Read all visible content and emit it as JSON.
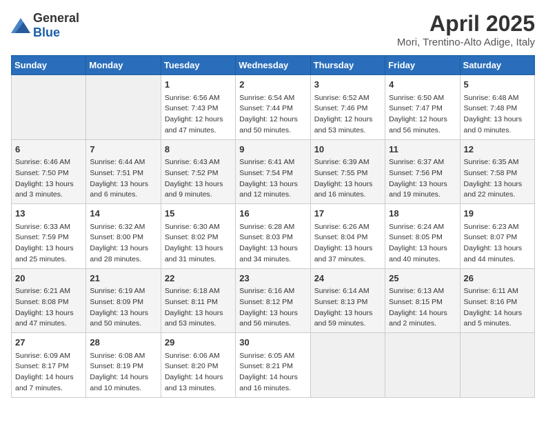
{
  "logo": {
    "text_general": "General",
    "text_blue": "Blue"
  },
  "title": "April 2025",
  "subtitle": "Mori, Trentino-Alto Adige, Italy",
  "days_of_week": [
    "Sunday",
    "Monday",
    "Tuesday",
    "Wednesday",
    "Thursday",
    "Friday",
    "Saturday"
  ],
  "weeks": [
    [
      {
        "day": "",
        "sunrise": "",
        "sunset": "",
        "daylight": ""
      },
      {
        "day": "",
        "sunrise": "",
        "sunset": "",
        "daylight": ""
      },
      {
        "day": "1",
        "sunrise": "Sunrise: 6:56 AM",
        "sunset": "Sunset: 7:43 PM",
        "daylight": "Daylight: 12 hours and 47 minutes."
      },
      {
        "day": "2",
        "sunrise": "Sunrise: 6:54 AM",
        "sunset": "Sunset: 7:44 PM",
        "daylight": "Daylight: 12 hours and 50 minutes."
      },
      {
        "day": "3",
        "sunrise": "Sunrise: 6:52 AM",
        "sunset": "Sunset: 7:46 PM",
        "daylight": "Daylight: 12 hours and 53 minutes."
      },
      {
        "day": "4",
        "sunrise": "Sunrise: 6:50 AM",
        "sunset": "Sunset: 7:47 PM",
        "daylight": "Daylight: 12 hours and 56 minutes."
      },
      {
        "day": "5",
        "sunrise": "Sunrise: 6:48 AM",
        "sunset": "Sunset: 7:48 PM",
        "daylight": "Daylight: 13 hours and 0 minutes."
      }
    ],
    [
      {
        "day": "6",
        "sunrise": "Sunrise: 6:46 AM",
        "sunset": "Sunset: 7:50 PM",
        "daylight": "Daylight: 13 hours and 3 minutes."
      },
      {
        "day": "7",
        "sunrise": "Sunrise: 6:44 AM",
        "sunset": "Sunset: 7:51 PM",
        "daylight": "Daylight: 13 hours and 6 minutes."
      },
      {
        "day": "8",
        "sunrise": "Sunrise: 6:43 AM",
        "sunset": "Sunset: 7:52 PM",
        "daylight": "Daylight: 13 hours and 9 minutes."
      },
      {
        "day": "9",
        "sunrise": "Sunrise: 6:41 AM",
        "sunset": "Sunset: 7:54 PM",
        "daylight": "Daylight: 13 hours and 12 minutes."
      },
      {
        "day": "10",
        "sunrise": "Sunrise: 6:39 AM",
        "sunset": "Sunset: 7:55 PM",
        "daylight": "Daylight: 13 hours and 16 minutes."
      },
      {
        "day": "11",
        "sunrise": "Sunrise: 6:37 AM",
        "sunset": "Sunset: 7:56 PM",
        "daylight": "Daylight: 13 hours and 19 minutes."
      },
      {
        "day": "12",
        "sunrise": "Sunrise: 6:35 AM",
        "sunset": "Sunset: 7:58 PM",
        "daylight": "Daylight: 13 hours and 22 minutes."
      }
    ],
    [
      {
        "day": "13",
        "sunrise": "Sunrise: 6:33 AM",
        "sunset": "Sunset: 7:59 PM",
        "daylight": "Daylight: 13 hours and 25 minutes."
      },
      {
        "day": "14",
        "sunrise": "Sunrise: 6:32 AM",
        "sunset": "Sunset: 8:00 PM",
        "daylight": "Daylight: 13 hours and 28 minutes."
      },
      {
        "day": "15",
        "sunrise": "Sunrise: 6:30 AM",
        "sunset": "Sunset: 8:02 PM",
        "daylight": "Daylight: 13 hours and 31 minutes."
      },
      {
        "day": "16",
        "sunrise": "Sunrise: 6:28 AM",
        "sunset": "Sunset: 8:03 PM",
        "daylight": "Daylight: 13 hours and 34 minutes."
      },
      {
        "day": "17",
        "sunrise": "Sunrise: 6:26 AM",
        "sunset": "Sunset: 8:04 PM",
        "daylight": "Daylight: 13 hours and 37 minutes."
      },
      {
        "day": "18",
        "sunrise": "Sunrise: 6:24 AM",
        "sunset": "Sunset: 8:05 PM",
        "daylight": "Daylight: 13 hours and 40 minutes."
      },
      {
        "day": "19",
        "sunrise": "Sunrise: 6:23 AM",
        "sunset": "Sunset: 8:07 PM",
        "daylight": "Daylight: 13 hours and 44 minutes."
      }
    ],
    [
      {
        "day": "20",
        "sunrise": "Sunrise: 6:21 AM",
        "sunset": "Sunset: 8:08 PM",
        "daylight": "Daylight: 13 hours and 47 minutes."
      },
      {
        "day": "21",
        "sunrise": "Sunrise: 6:19 AM",
        "sunset": "Sunset: 8:09 PM",
        "daylight": "Daylight: 13 hours and 50 minutes."
      },
      {
        "day": "22",
        "sunrise": "Sunrise: 6:18 AM",
        "sunset": "Sunset: 8:11 PM",
        "daylight": "Daylight: 13 hours and 53 minutes."
      },
      {
        "day": "23",
        "sunrise": "Sunrise: 6:16 AM",
        "sunset": "Sunset: 8:12 PM",
        "daylight": "Daylight: 13 hours and 56 minutes."
      },
      {
        "day": "24",
        "sunrise": "Sunrise: 6:14 AM",
        "sunset": "Sunset: 8:13 PM",
        "daylight": "Daylight: 13 hours and 59 minutes."
      },
      {
        "day": "25",
        "sunrise": "Sunrise: 6:13 AM",
        "sunset": "Sunset: 8:15 PM",
        "daylight": "Daylight: 14 hours and 2 minutes."
      },
      {
        "day": "26",
        "sunrise": "Sunrise: 6:11 AM",
        "sunset": "Sunset: 8:16 PM",
        "daylight": "Daylight: 14 hours and 5 minutes."
      }
    ],
    [
      {
        "day": "27",
        "sunrise": "Sunrise: 6:09 AM",
        "sunset": "Sunset: 8:17 PM",
        "daylight": "Daylight: 14 hours and 7 minutes."
      },
      {
        "day": "28",
        "sunrise": "Sunrise: 6:08 AM",
        "sunset": "Sunset: 8:19 PM",
        "daylight": "Daylight: 14 hours and 10 minutes."
      },
      {
        "day": "29",
        "sunrise": "Sunrise: 6:06 AM",
        "sunset": "Sunset: 8:20 PM",
        "daylight": "Daylight: 14 hours and 13 minutes."
      },
      {
        "day": "30",
        "sunrise": "Sunrise: 6:05 AM",
        "sunset": "Sunset: 8:21 PM",
        "daylight": "Daylight: 14 hours and 16 minutes."
      },
      {
        "day": "",
        "sunrise": "",
        "sunset": "",
        "daylight": ""
      },
      {
        "day": "",
        "sunrise": "",
        "sunset": "",
        "daylight": ""
      },
      {
        "day": "",
        "sunrise": "",
        "sunset": "",
        "daylight": ""
      }
    ]
  ]
}
